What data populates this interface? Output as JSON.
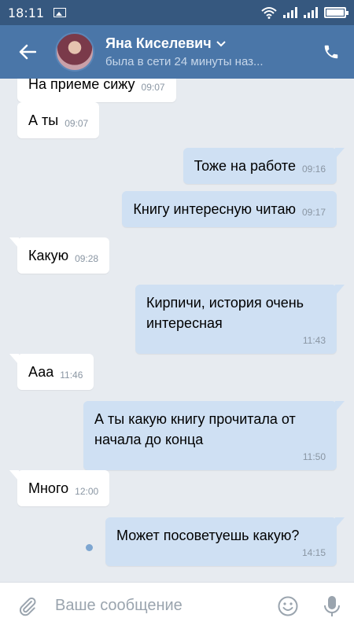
{
  "statusbar": {
    "time": "18:11"
  },
  "header": {
    "name": "Яна Киселевич",
    "status": "была в сети 24 минуты наз..."
  },
  "messages": [
    {
      "dir": "in",
      "text": "На приеме сижу",
      "time": "09:07"
    },
    {
      "dir": "in",
      "text": "А ты",
      "time": "09:07"
    },
    {
      "dir": "out",
      "text": "Тоже на работе",
      "time": "09:16"
    },
    {
      "dir": "out",
      "text": "Книгу интересную читаю",
      "time": "09:17"
    },
    {
      "dir": "in",
      "text": "Какую",
      "time": "09:28"
    },
    {
      "dir": "out",
      "text": "Кирпичи, история очень интересная",
      "time": "11:43"
    },
    {
      "dir": "in",
      "text": "Ааа",
      "time": "11:46"
    },
    {
      "dir": "out",
      "text": "А ты какую книгу прочитала от начала до конца",
      "time": "11:50"
    },
    {
      "dir": "in",
      "text": "Много",
      "time": "12:00"
    },
    {
      "dir": "out",
      "text": "Может посоветуешь какую?",
      "time": "14:15"
    }
  ],
  "composer": {
    "placeholder": "Ваше сообщение"
  },
  "colors": {
    "header": "#4a76a8",
    "statusbar": "#36587f",
    "outgoing": "#cfe0f3",
    "background": "#e7ebf0"
  },
  "icons": [
    "image-icon",
    "wifi-icon",
    "signal-icon",
    "battery-icon",
    "back-arrow-icon",
    "chevron-down-icon",
    "phone-icon",
    "attach-icon",
    "emoji-icon",
    "microphone-icon"
  ]
}
